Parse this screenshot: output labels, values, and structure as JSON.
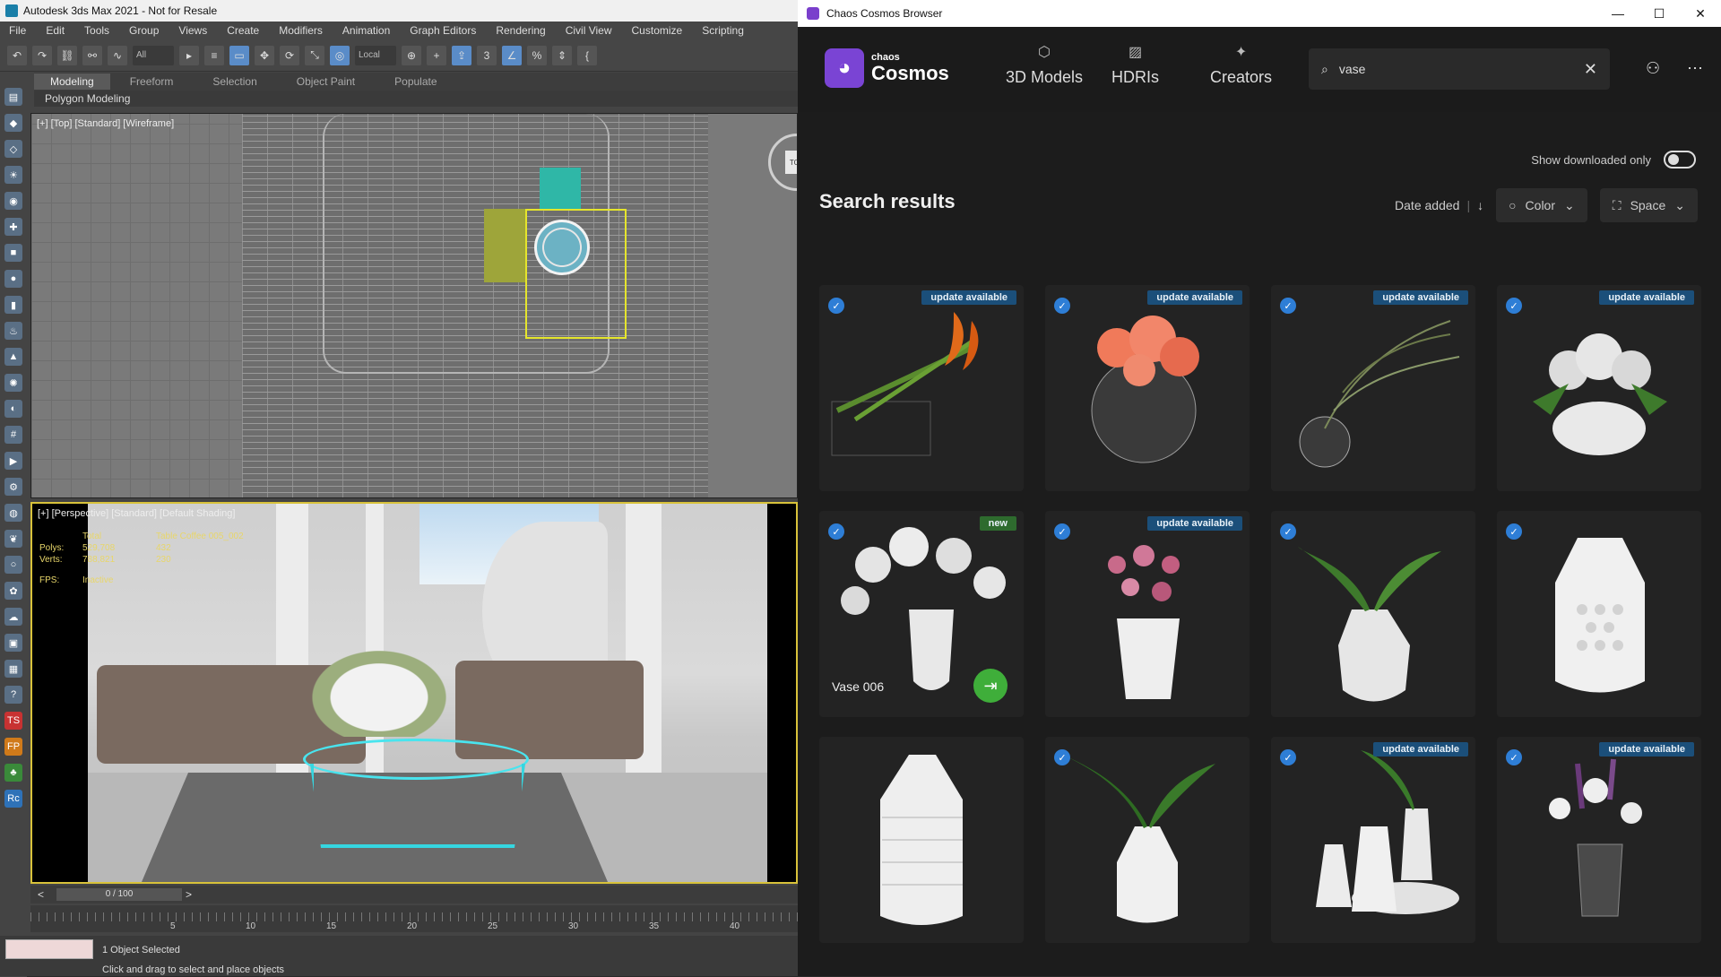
{
  "max": {
    "title": "Autodesk 3ds Max 2021 - Not for Resale",
    "menu": [
      "File",
      "Edit",
      "Tools",
      "Group",
      "Views",
      "Create",
      "Modifiers",
      "Animation",
      "Graph Editors",
      "Rendering",
      "Civil View",
      "Customize",
      "Scripting"
    ],
    "selection_filter": "All",
    "coord_system": "Local",
    "ribbon_tabs": [
      "Modeling",
      "Freeform",
      "Selection",
      "Object Paint",
      "Populate"
    ],
    "ribbon_active": "Modeling",
    "ribbon_sub": "Polygon Modeling",
    "viewport_top_label": "[+] [Top] [Standard] [Wireframe]",
    "viewport_persp_label": "[+] [Perspective] [Standard] [Default Shading]",
    "viewcube_label": "TOP",
    "stats": {
      "col_total": "Total",
      "col_object": "Table Coffee 005_002",
      "polys_label": "Polys:",
      "polys_total": "529,708",
      "polys_obj": "432",
      "verts_label": "Verts:",
      "verts_total": "788,821",
      "verts_obj": "230",
      "fps_label": "FPS:",
      "fps_value": "Inactive"
    },
    "timeline": "0 / 100",
    "ruler_ticks": [
      "5",
      "10",
      "15",
      "20",
      "25",
      "30",
      "35",
      "40"
    ],
    "status_line1": "1 Object Selected",
    "status_line2": "Click and drag to select and place objects"
  },
  "cosmos": {
    "window_title": "Chaos Cosmos Browser",
    "brand_small": "chaos",
    "brand_big": "Cosmos",
    "tabs": [
      "3D Models",
      "HDRIs",
      "Creators"
    ],
    "search_value": "vase",
    "show_downloaded": "Show downloaded only",
    "results_title": "Search results",
    "sort_label": "Date added",
    "filter_color": "Color",
    "filter_space": "Space",
    "cards": [
      {
        "badge": "update available",
        "checked": true,
        "name": ""
      },
      {
        "badge": "update available",
        "checked": true,
        "name": ""
      },
      {
        "badge": "update available",
        "checked": true,
        "name": ""
      },
      {
        "badge": "update available",
        "checked": true,
        "name": ""
      },
      {
        "badge": "new",
        "checked": true,
        "name": "Vase 006"
      },
      {
        "badge": "update available",
        "checked": true,
        "name": ""
      },
      {
        "badge": "",
        "checked": true,
        "name": ""
      },
      {
        "badge": "",
        "checked": true,
        "name": ""
      },
      {
        "badge": "",
        "checked": false,
        "name": ""
      },
      {
        "badge": "",
        "checked": true,
        "name": ""
      },
      {
        "badge": "update available",
        "checked": true,
        "name": ""
      },
      {
        "badge": "update available",
        "checked": true,
        "name": ""
      }
    ]
  }
}
